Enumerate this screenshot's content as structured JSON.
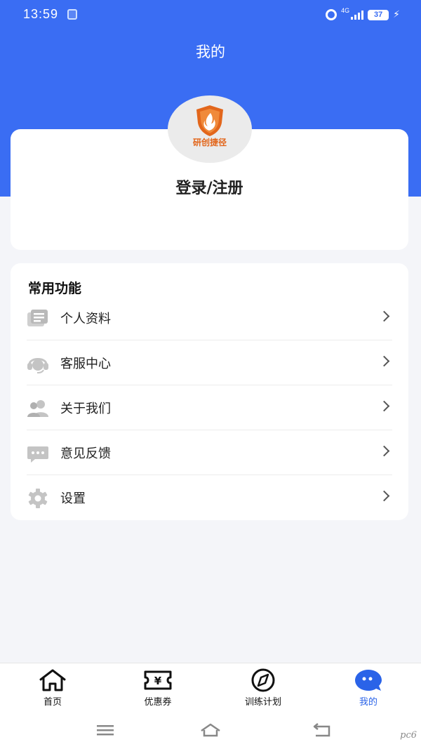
{
  "status_bar": {
    "time": "13:59",
    "network": "4G",
    "battery": "37"
  },
  "page": {
    "title": "我的"
  },
  "profile": {
    "avatar_text": "研创捷径",
    "login_label": "登录/注册"
  },
  "functions": {
    "title": "常用功能",
    "items": [
      {
        "label": "个人资料",
        "icon": "id-card-icon"
      },
      {
        "label": "客服中心",
        "icon": "headset-icon"
      },
      {
        "label": "关于我们",
        "icon": "users-icon"
      },
      {
        "label": "意见反馈",
        "icon": "message-icon"
      },
      {
        "label": "设置",
        "icon": "gear-icon"
      }
    ]
  },
  "tabs": [
    {
      "label": "首页",
      "icon": "home-icon",
      "active": false
    },
    {
      "label": "优惠券",
      "icon": "coupon-icon",
      "active": false
    },
    {
      "label": "训练计划",
      "icon": "compass-icon",
      "active": false
    },
    {
      "label": "我的",
      "icon": "chat-bubble-icon",
      "active": true
    }
  ],
  "colors": {
    "brand_blue": "#3a6df3",
    "active_tab": "#2a63e8",
    "logo_orange": "#e2661b"
  },
  "watermark": "pc6"
}
